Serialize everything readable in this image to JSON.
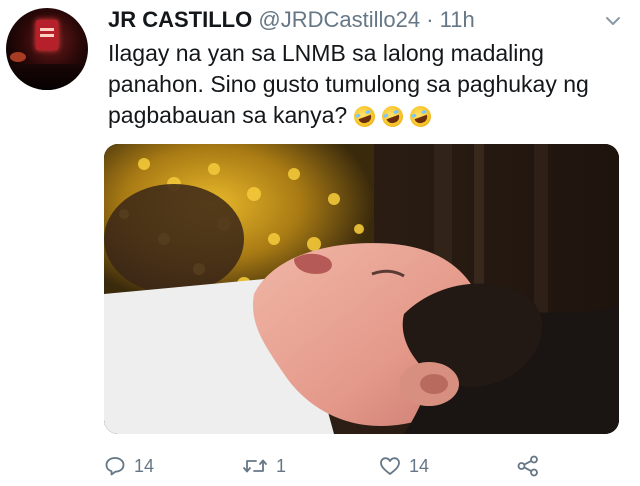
{
  "tweet": {
    "author": {
      "name": "JR CASTILLO",
      "handle": "@JRDCastillo24",
      "separator": "·",
      "time": "11h"
    },
    "text": "Ilagay na yan sa LNMB sa lalong madaling panahon. Sino gusto tumulong sa paghukay ng pagbabauan sa kanya?",
    "emojis": [
      "rolling-on-floor-laughing",
      "rolling-on-floor-laughing",
      "rolling-on-floor-laughing"
    ],
    "media": {
      "kind": "photo"
    },
    "actions": {
      "reply_count": "14",
      "retweet_count": "1",
      "like_count": "14"
    }
  },
  "icons": {
    "caret": "chevron-down-icon",
    "reply": "reply-icon",
    "retweet": "retweet-icon",
    "like": "heart-icon",
    "share": "share-icon"
  },
  "colors": {
    "text": "#14171a",
    "secondary": "#657786"
  }
}
